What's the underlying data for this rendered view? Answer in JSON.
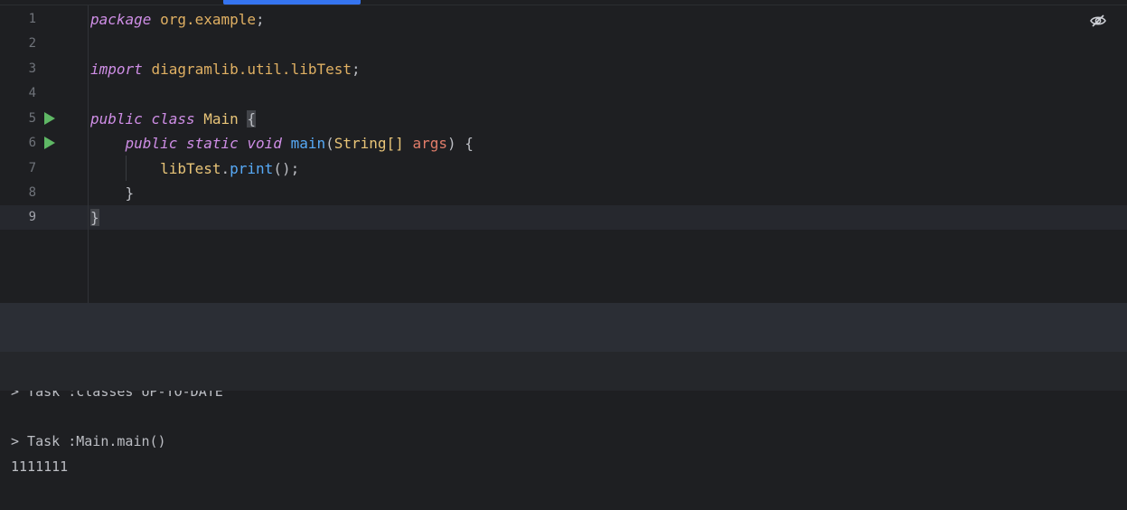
{
  "editor": {
    "line_numbers": [
      "1",
      "2",
      "3",
      "4",
      "5",
      "6",
      "7",
      "8",
      "9"
    ],
    "lines": {
      "l1": {
        "kw": "package",
        "rest": "org.example",
        "semi": ";"
      },
      "l3": {
        "kw": "import",
        "rest": "diagramlib.util.libTest",
        "semi": ";"
      },
      "l5": {
        "kw1": "public",
        "kw2": "class",
        "cls": "Main",
        "brace": "{"
      },
      "l6": {
        "kw1": "public",
        "kw2": "static",
        "kw3": "void",
        "fn": "main",
        "open": "(",
        "type": "String[]",
        "param": "args",
        "close": ") {"
      },
      "l7": {
        "obj": "libTest",
        "dot": ".",
        "fn": "print",
        "tail": "();"
      },
      "l8": {
        "brace": "}"
      },
      "l9": {
        "brace": "}"
      }
    },
    "reader_mode_icon": "eye-slash-icon",
    "run_icon": "run-gutter-icon",
    "colors": {
      "keyword": "#cf8ee6",
      "class": "#e8c478",
      "function": "#57aaf7",
      "param": "#e27d6a",
      "run": "#5fb865",
      "accent": "#3574f0"
    }
  },
  "console": {
    "partial_line": "> Task :classes UP-TO-DATE",
    "task_line": "> Task :Main.main()",
    "output_line": "1111111"
  }
}
